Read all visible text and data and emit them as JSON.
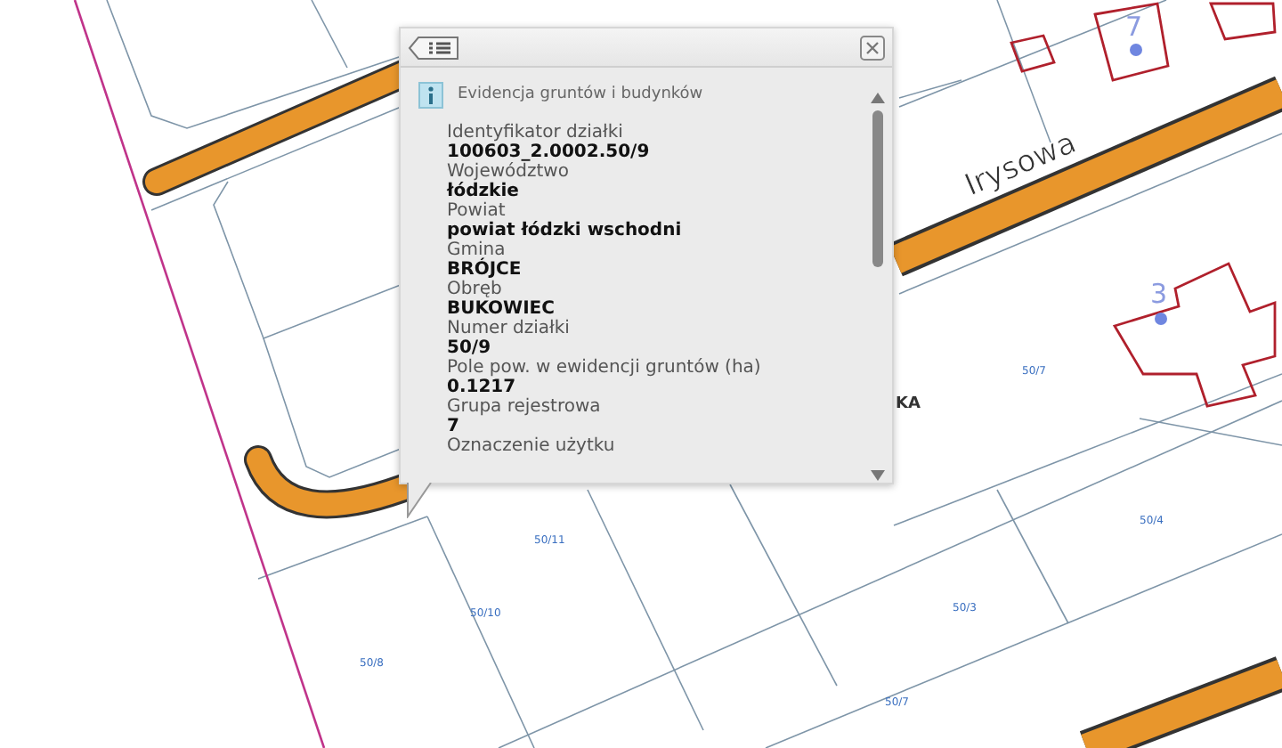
{
  "map": {
    "street_label": "Irysowa",
    "partial_label": "KA",
    "house_numbers": [
      "7",
      "3"
    ],
    "parcel_labels": [
      "50/7",
      "50/11",
      "50/10",
      "50/8",
      "50/3",
      "50/4",
      "50/7"
    ]
  },
  "popup": {
    "title": "Evidencja gruntów i budynków",
    "fields": [
      {
        "label": "Identyfikator działki",
        "value": "100603_2.0002.50/9"
      },
      {
        "label": "Województwo",
        "value": "łódzkie"
      },
      {
        "label": "Powiat",
        "value": "powiat łódzki wschodni"
      },
      {
        "label": "Gmina",
        "value": "BRÓJCE"
      },
      {
        "label": "Obręb",
        "value": "BUKOWIEC"
      },
      {
        "label": "Numer działki",
        "value": "50/9"
      },
      {
        "label": "Pole pow. w ewidencji gruntów (ha)",
        "value": "0.1217"
      },
      {
        "label": "Grupa rejestrowa",
        "value": "7"
      },
      {
        "label": "Oznaczenie użytku"
      }
    ]
  }
}
